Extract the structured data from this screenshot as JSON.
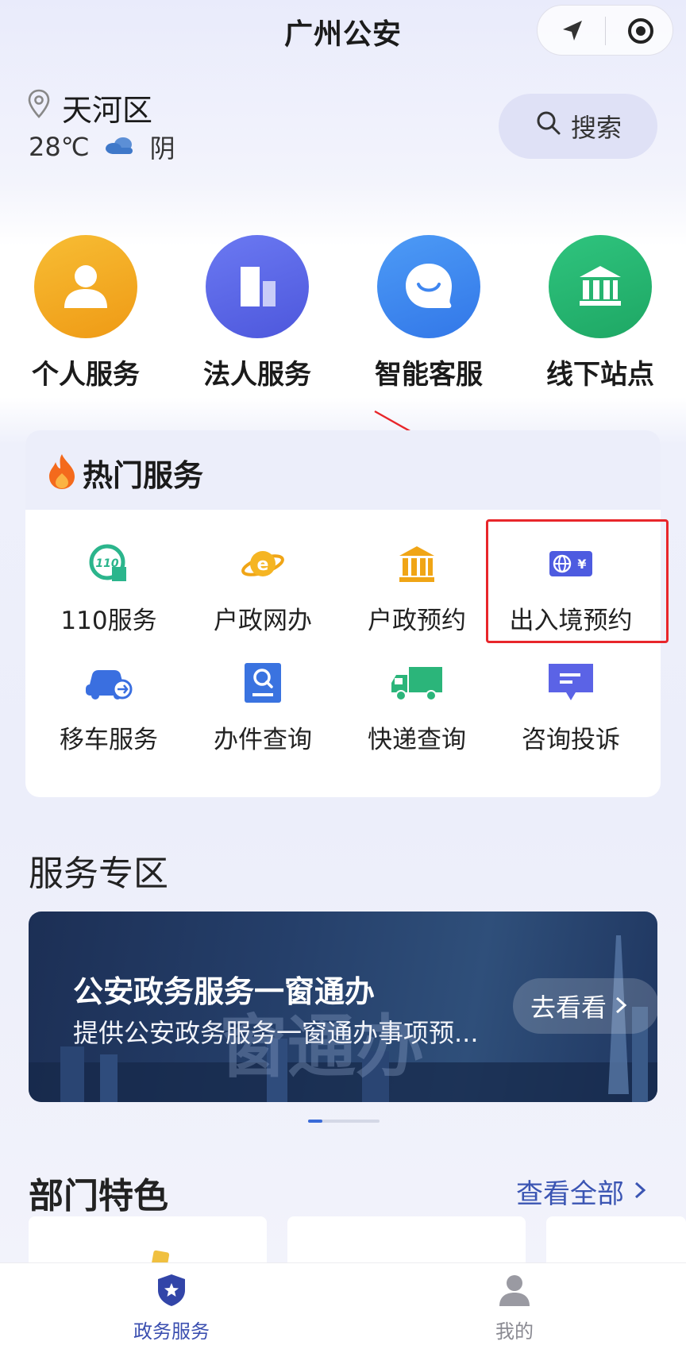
{
  "header": {
    "title": "广州公安"
  },
  "location": {
    "district": "天河区",
    "temperature": "28℃",
    "weather": "阴"
  },
  "search": {
    "label": "搜索"
  },
  "quick_services": [
    {
      "label": "个人服务",
      "icon": "person-icon",
      "color": "#f3a722"
    },
    {
      "label": "法人服务",
      "icon": "building-icon",
      "color": "#5866e8"
    },
    {
      "label": "智能客服",
      "icon": "chat-icon",
      "color": "#3f86f0"
    },
    {
      "label": "线下站点",
      "icon": "bank-icon",
      "color": "#25b571"
    }
  ],
  "hot_services": {
    "title": "热门服务",
    "items": [
      {
        "label": "110服务",
        "icon": "110-icon"
      },
      {
        "label": "户政网办",
        "icon": "e-globe-icon"
      },
      {
        "label": "户政预约",
        "icon": "bank-icon"
      },
      {
        "label": "出入境预约",
        "icon": "passport-currency-icon"
      },
      {
        "label": "移车服务",
        "icon": "car-icon"
      },
      {
        "label": "办件查询",
        "icon": "document-search-icon"
      },
      {
        "label": "快递查询",
        "icon": "truck-icon"
      },
      {
        "label": "咨询投诉",
        "icon": "message-icon"
      }
    ]
  },
  "service_zone": {
    "title": "服务专区",
    "banner": {
      "title": "公安政务服务一窗通办",
      "subtitle": "提供公安政务服务一窗通办事项预...",
      "button": "去看看",
      "watermark": "窗通办"
    }
  },
  "department": {
    "title": "部门特色",
    "view_all": "查看全部"
  },
  "tabbar": [
    {
      "label": "政务服务",
      "active": true
    },
    {
      "label": "我的",
      "active": false
    }
  ],
  "colors": {
    "accent": "#3b55b3",
    "highlight_box": "#e8262b"
  }
}
